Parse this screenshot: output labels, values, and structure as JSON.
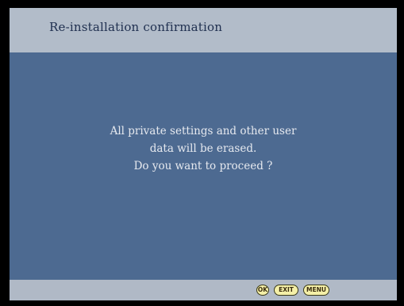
{
  "dialog": {
    "title": "Re-installation confirmation",
    "message": {
      "line1": "All private settings and other user",
      "line2": "data will be erased.",
      "line3": "Do you want to proceed ?"
    }
  },
  "footer": {
    "ok_label": "OK",
    "exit_label": "EXIT",
    "menu_label": "MENU"
  },
  "colors": {
    "background": "#4d6a91",
    "header": "#b2bcc9",
    "footer": "#b0b9c6",
    "button_fill": "#f5f0a8"
  }
}
